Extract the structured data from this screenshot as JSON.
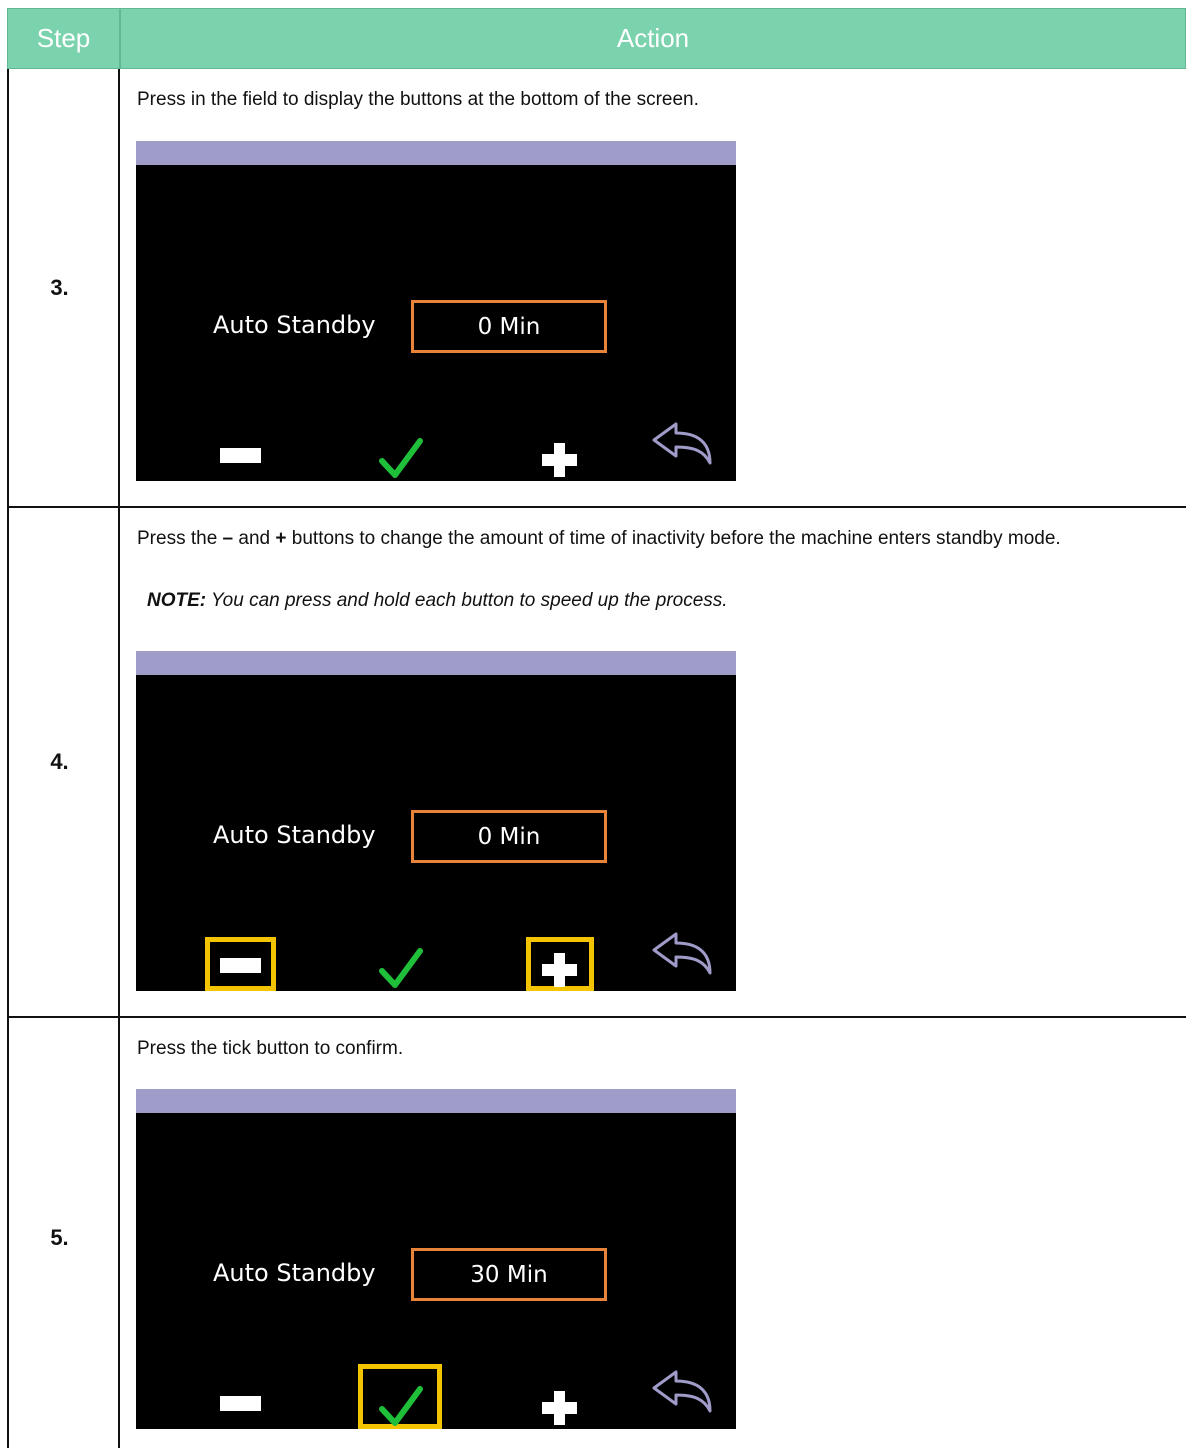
{
  "table": {
    "header_step": "Step",
    "header_action": "Action"
  },
  "rows": [
    {
      "step": "3.",
      "text": "Press in the field to display the buttons at the bottom of the screen.",
      "screen": {
        "label": "Auto Standby",
        "value": "0 Min"
      }
    },
    {
      "step": "4.",
      "text_parts": [
        "Press the ",
        "–",
        " and ",
        "+",
        " buttons to change the amount of time of inactivity before the machine enters standby mode."
      ],
      "note_prefix": "NOTE:",
      "note_text": " You can press and hold each button to speed up the process.",
      "screen": {
        "label": "Auto Standby",
        "value": "0 Min"
      }
    },
    {
      "step": "5.",
      "text": "Press the tick button to confirm.",
      "screen": {
        "label": "Auto Standby",
        "value": "30 Min"
      }
    }
  ],
  "icons": {
    "minus": "minus-icon",
    "tick": "tick-icon",
    "plus": "plus-icon",
    "back": "back-arrow-icon"
  },
  "colors": {
    "header_bg": "#7bd3ad",
    "screen_topbar": "#a09cc9",
    "field_border": "#e8843a",
    "tick_green": "#1fbf3a",
    "highlight": "#f5c400"
  }
}
